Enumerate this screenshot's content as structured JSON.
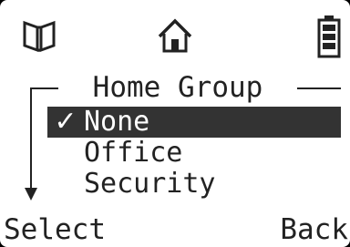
{
  "status_bar": {
    "icons": [
      "book-icon",
      "home-icon",
      "battery-icon"
    ]
  },
  "menu": {
    "title": "Home Group",
    "selected_marker": "✓",
    "items": [
      {
        "label": "None",
        "selected": true
      },
      {
        "label": "Office",
        "selected": false
      },
      {
        "label": "Security",
        "selected": false
      }
    ],
    "scroll_indicator": "down-arrow-icon"
  },
  "softkeys": {
    "left_label": "Select",
    "right_label": "Back"
  },
  "colors": {
    "screen_bg": "#ffffff",
    "text": "#222222",
    "highlight_bg": "#333333",
    "highlight_text": "#ffffff",
    "frame": "#000000"
  }
}
